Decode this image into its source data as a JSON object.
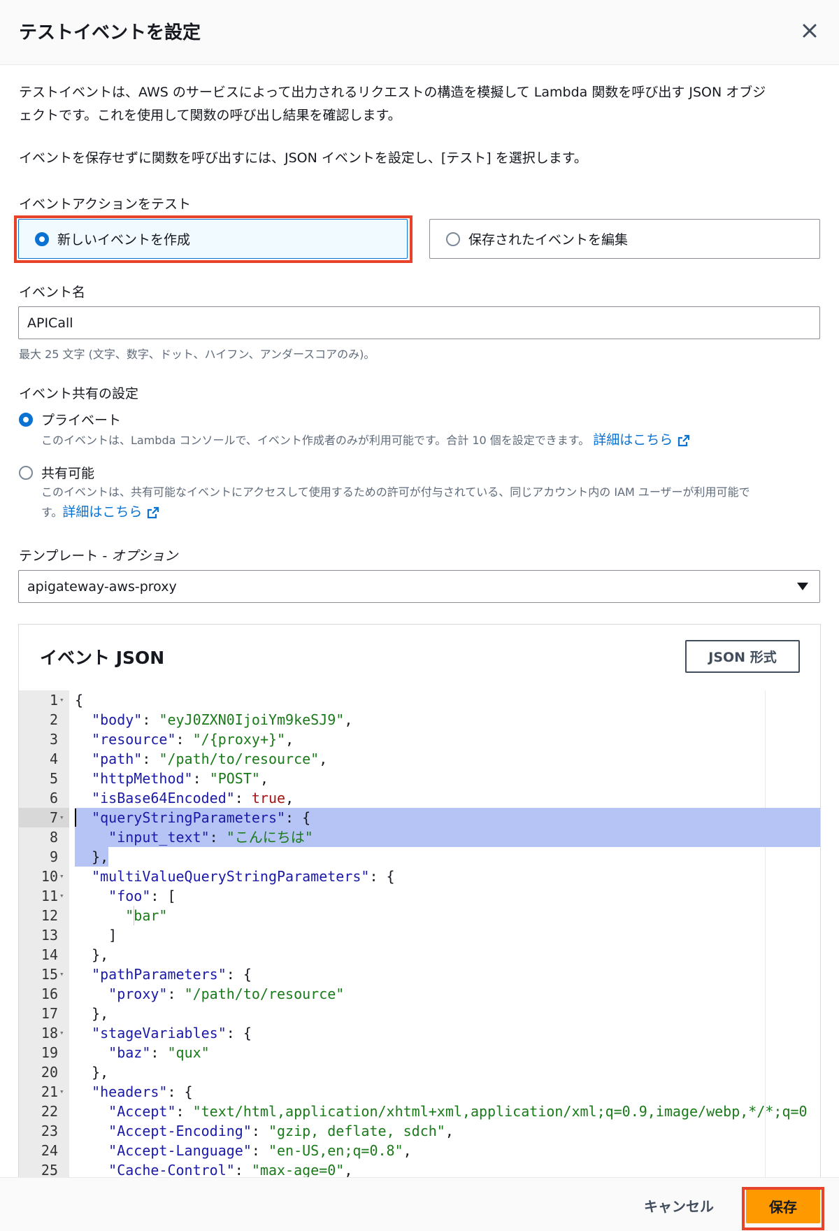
{
  "modal": {
    "title": "テストイベントを設定",
    "close_icon": "close-icon"
  },
  "intro": {
    "para1_line1": "テストイベントは、AWS のサービスによって出力されるリクエストの構造を模擬して Lambda 関数を呼び出す JSON オブジ",
    "para1_line2": "ェクトです。これを使用して関数の呼び出し結果を確認します。",
    "para2": "イベントを保存せずに関数を呼び出すには、JSON イベントを設定し、[テスト] を選択します。"
  },
  "event_action": {
    "label": "イベントアクションをテスト",
    "options": [
      {
        "label": "新しいイベントを作成",
        "selected": true
      },
      {
        "label": "保存されたイベントを編集",
        "selected": false
      }
    ]
  },
  "event_name": {
    "label": "イベント名",
    "value": "APICall",
    "hint": "最大 25 文字 (文字、数字、ドット、ハイフン、アンダースコアのみ)。"
  },
  "sharing": {
    "label": "イベント共有の設定",
    "private_label": "プライベート",
    "private_desc": "このイベントは、Lambda コンソールで、イベント作成者のみが利用可能です。合計 10 個を設定できます。",
    "private_link": "詳細はこちら",
    "shared_label": "共有可能",
    "shared_desc_line1": "このイベントは、共有可能なイベントにアクセスして使用するための許可が付与されている、同じアカウント内の IAM ユーザーが利用可能で",
    "shared_desc_line2": "す。",
    "shared_link": "詳細はこちら",
    "selected": "private"
  },
  "template": {
    "label_main": "テンプレート - ",
    "label_italic": "オプション",
    "value": "apigateway-aws-proxy"
  },
  "json_editor": {
    "title": "イベント JSON",
    "format_button": "JSON 形式",
    "lines": [
      "{",
      "  \"body\": \"eyJ0ZXN0IjoiYm9keSJ9\",",
      "  \"resource\": \"/{proxy+}\",",
      "  \"path\": \"/path/to/resource\",",
      "  \"httpMethod\": \"POST\",",
      "  \"isBase64Encoded\": true,",
      "  \"queryStringParameters\": {",
      "    \"input_text\": \"こんにちは\"",
      "  },",
      "  \"multiValueQueryStringParameters\": {",
      "    \"foo\": [",
      "      \"bar\"",
      "    ]",
      "  },",
      "  \"pathParameters\": {",
      "    \"proxy\": \"/path/to/resource\"",
      "  },",
      "  \"stageVariables\": {",
      "    \"baz\": \"qux\"",
      "  },",
      "  \"headers\": {",
      "    \"Accept\": \"text/html,application/xhtml+xml,application/xml;q=0.9,image/webp,*/*;q=0",
      "    \"Accept-Encoding\": \"gzip, deflate, sdch\",",
      "    \"Accept-Language\": \"en-US,en;q=0.8\",",
      "    \"Cache-Control\": \"max-age=0\","
    ],
    "foldable_lines": [
      1,
      7,
      10,
      11,
      15,
      18,
      21
    ],
    "selected_lines": [
      7,
      8,
      9
    ],
    "active_line": 7
  },
  "footer": {
    "cancel": "キャンセル",
    "save": "保存"
  },
  "colors": {
    "accent": "#0972d3",
    "primary_button": "#ff9900",
    "highlight_box": "#e6432a",
    "selection": "#b5c4f5"
  }
}
